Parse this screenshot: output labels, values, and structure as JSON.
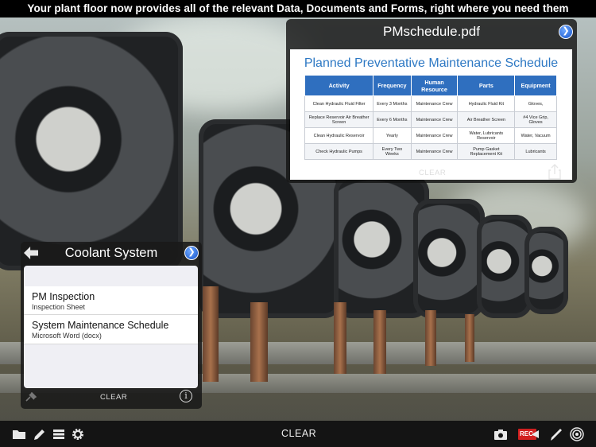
{
  "caption": "Your plant floor now provides all of the relevant Data, Documents and Forms, right  where you need them",
  "pdf_panel": {
    "title": "PMschedule.pdf",
    "doc_title": "Planned Preventative Maintenance Schedule",
    "columns": [
      "Activity",
      "Frequency",
      "Human Resource",
      "Parts",
      "Equipment"
    ],
    "rows": [
      [
        "Clean Hydraulic Fluid Filter",
        "Every 3 Months",
        "Maintenance Crew",
        "Hydraulic Fluid Kit",
        "Gloves,"
      ],
      [
        "Replace Reservoir Air Breather Screen",
        "Every 6 Months",
        "Maintenance Crew",
        "Air Breather Screen",
        "#4 Vice Grip, Gloves"
      ],
      [
        "Clean Hydraulic Reservoir",
        "Yearly",
        "Maintenance Crew",
        "Water, Lubricants Reservoir",
        "Water, Vacuum"
      ],
      [
        "Check Hydraulic Pumps",
        "Every Two Weeks",
        "Maintenance Crew",
        "Pump Gasket Replacement Kit",
        "Lubricants"
      ]
    ],
    "clear_label": "CLEAR"
  },
  "coolant_panel": {
    "title": "Coolant System",
    "items": [
      {
        "main": "PM Inspection",
        "sub": "Inspection Sheet"
      },
      {
        "main": "System Maintenance Schedule",
        "sub": "Microsoft Word (docx)"
      }
    ],
    "clear_label": "CLEAR",
    "info_glyph": "i"
  },
  "toolbar": {
    "clear_label": "CLEAR",
    "rec_label": "REC."
  },
  "colors": {
    "accent_blue": "#2f6fbf",
    "rec_red": "#d11f1f",
    "toolbar_bg": "#141414"
  }
}
